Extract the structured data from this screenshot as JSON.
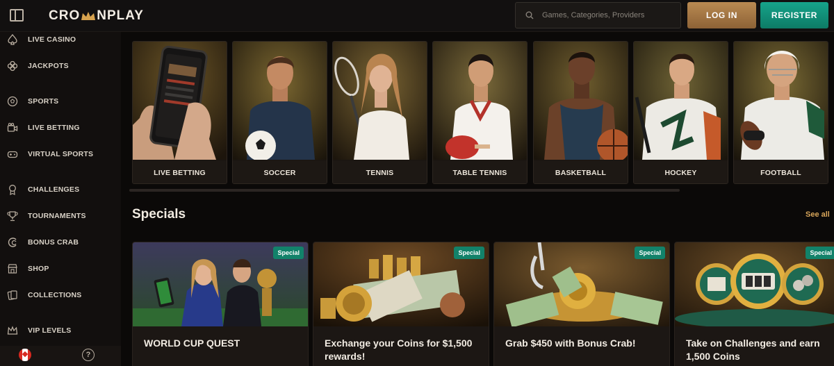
{
  "header": {
    "logo_text_left": "CRO",
    "logo_text_right": "NPLAY",
    "search_placeholder": "Games, Categories, Providers",
    "login_label": "LOG IN",
    "register_label": "REGISTER"
  },
  "sidebar": {
    "items": [
      {
        "label": "LIVE CASINO",
        "icon": "spade-icon"
      },
      {
        "label": "JACKPOTS",
        "icon": "clover-icon"
      },
      {
        "label": "SPORTS",
        "icon": "soccer-ball-icon"
      },
      {
        "label": "LIVE BETTING",
        "icon": "video-camera-icon"
      },
      {
        "label": "VIRTUAL SPORTS",
        "icon": "gamepad-icon"
      },
      {
        "label": "CHALLENGES",
        "icon": "medal-icon"
      },
      {
        "label": "TOURNAMENTS",
        "icon": "trophy-icon"
      },
      {
        "label": "BONUS CRAB",
        "icon": "crab-icon"
      },
      {
        "label": "SHOP",
        "icon": "shop-icon"
      },
      {
        "label": "COLLECTIONS",
        "icon": "cards-icon"
      },
      {
        "label": "VIP LEVELS",
        "icon": "crown-icon"
      }
    ],
    "help_label": "?"
  },
  "sports": [
    {
      "label": "LIVE BETTING",
      "icon": "phone-icon"
    },
    {
      "label": "SOCCER",
      "icon": "soccer-player-icon"
    },
    {
      "label": "TENNIS",
      "icon": "tennis-player-icon"
    },
    {
      "label": "TABLE TENNIS",
      "icon": "table-tennis-player-icon"
    },
    {
      "label": "BASKETBALL",
      "icon": "basketball-player-icon"
    },
    {
      "label": "HOCKEY",
      "icon": "hockey-player-icon"
    },
    {
      "label": "FOOTBALL",
      "icon": "football-player-icon"
    }
  ],
  "specials": {
    "title": "Specials",
    "see_all": "See all",
    "items": [
      {
        "tag": "Special",
        "title": "WORLD CUP QUEST"
      },
      {
        "tag": "Special",
        "title": "Exchange your Coins for $1,500 rewards!"
      },
      {
        "tag": "Special",
        "title": "Grab $450 with Bonus Crab!"
      },
      {
        "tag": "Special",
        "title": "Take on Challenges and earn 1,500 Coins"
      }
    ]
  },
  "colors": {
    "accent_gold": "#b98a52",
    "accent_teal": "#16a38a",
    "see_all": "#d7a55a"
  }
}
